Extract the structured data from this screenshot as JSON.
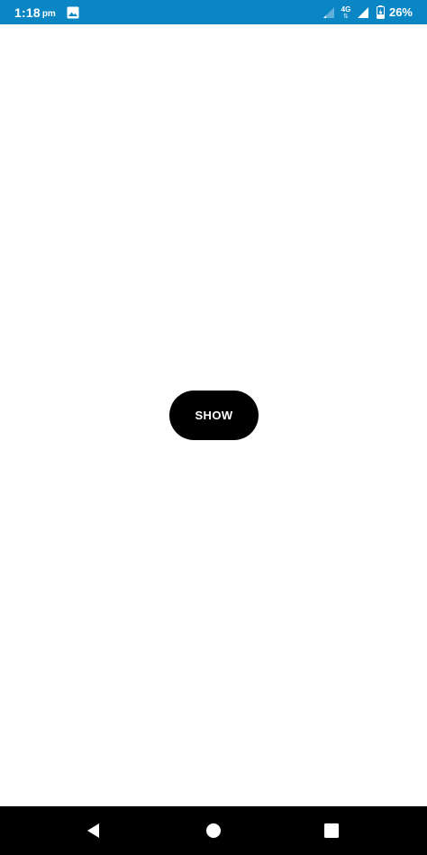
{
  "status_bar": {
    "time": "1:18",
    "ampm": "pm",
    "network_type": "4G",
    "network_arrows": "⇅",
    "battery_percent": "26%",
    "background_color": "#0a86c4"
  },
  "main": {
    "show_button_label": "SHOW"
  },
  "nav_bar": {
    "icons": [
      "back-icon",
      "home-icon",
      "recents-icon"
    ]
  }
}
